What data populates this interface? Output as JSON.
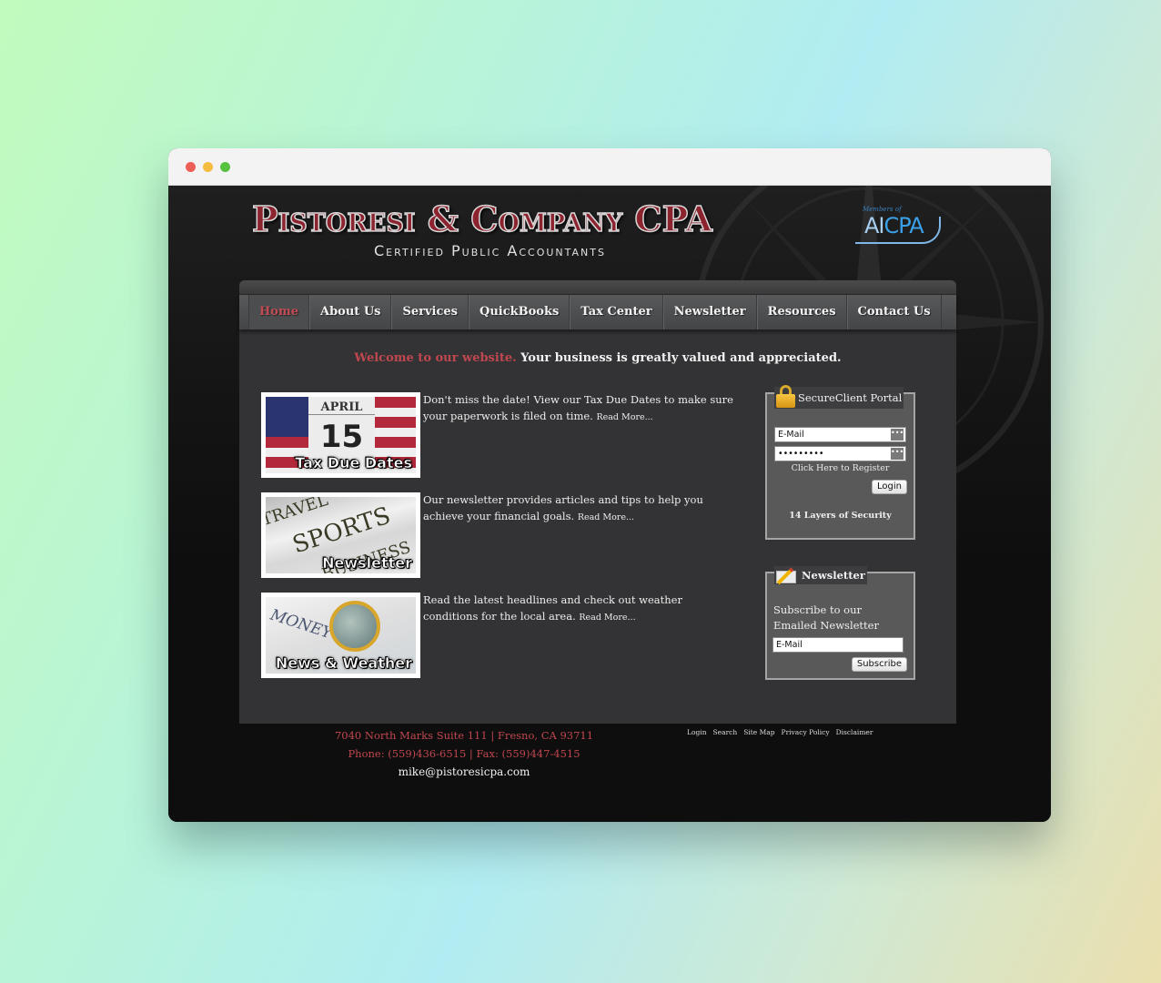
{
  "browser": {
    "controls": [
      "close",
      "minimize",
      "maximize"
    ]
  },
  "header": {
    "title": "Pistoresi & Company CPA",
    "subtitle": "Certified Public Accountants",
    "badge": {
      "prefix": "Members of",
      "mark_a": "AI",
      "mark_b": "CPA"
    }
  },
  "nav": {
    "items": [
      {
        "label": "Home",
        "active": true
      },
      {
        "label": "About Us"
      },
      {
        "label": "Services"
      },
      {
        "label": "QuickBooks"
      },
      {
        "label": "Tax Center"
      },
      {
        "label": "Newsletter"
      },
      {
        "label": "Resources"
      },
      {
        "label": "Contact Us"
      }
    ]
  },
  "welcome": {
    "highlight": "Welcome to our website.",
    "rest": " Your business is greatly valued and appreciated."
  },
  "features": [
    {
      "image_caption": "Tax Due Dates",
      "image_month": "APRIL",
      "image_day": "15",
      "text": "Don't miss the date! View our Tax Due Dates to make sure your paperwork is filed on time.",
      "more": "Read More..."
    },
    {
      "image_caption": "Newsletter",
      "image_words": [
        "TRAVEL",
        "SPORTS",
        "BUSINESS"
      ],
      "text": "Our newsletter provides articles and tips to help you achieve your financial goals.",
      "more": "Read More..."
    },
    {
      "image_caption": "News & Weather",
      "image_word": "MONEY",
      "text": "Read the latest headlines and check out weather conditions for the local area.",
      "more": "Read More..."
    }
  ],
  "portal": {
    "title": "SecureClient Portal",
    "email_value": "E-Mail",
    "password_value": "•••••••••",
    "field_button": "•••",
    "register_link": "Click Here to Register",
    "login_button": "Login",
    "security_text": "14 Layers of Security"
  },
  "newsletter": {
    "title": "Newsletter",
    "text_line1": "Subscribe to our",
    "text_line2": "Emailed Newsletter",
    "email_value": "E-Mail",
    "subscribe_button": "Subscribe"
  },
  "footer": {
    "address": "7040 North Marks Suite 111 | Fresno, CA 93711",
    "phone": "Phone: (559)436-6515 | Fax: (559)447-4515",
    "email": "mike@pistoresicpa.com",
    "links": [
      "Login",
      "Search",
      "Site Map",
      "Privacy Policy",
      "Disclaimer"
    ]
  },
  "colors": {
    "accent_red": "#c0474f",
    "nav_bg": "#4d4e50",
    "content_bg": "#333335",
    "page_bg": "#0e0e0e"
  }
}
